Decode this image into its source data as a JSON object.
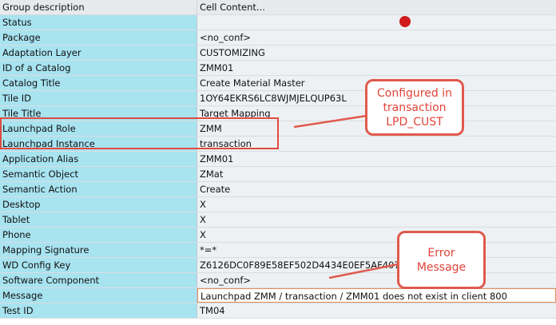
{
  "table": {
    "header": {
      "group": "Group description",
      "cell": "Cell Content..."
    },
    "rows": [
      {
        "label": "Status",
        "value": ""
      },
      {
        "label": "Package",
        "value": "<no_conf>"
      },
      {
        "label": "Adaptation Layer",
        "value": "CUSTOMIZING"
      },
      {
        "label": "ID of a Catalog",
        "value": "ZMM01"
      },
      {
        "label": "Catalog Title",
        "value": "Create Material Master"
      },
      {
        "label": "Tile ID",
        "value": "1OY64EKRS6LC8WJMJELQUP63L"
      },
      {
        "label": "Tile Title",
        "value": "Target Mapping"
      },
      {
        "label": "Launchpad Role",
        "value": "ZMM"
      },
      {
        "label": "Launchpad Instance",
        "value": "transaction"
      },
      {
        "label": "Application Alias",
        "value": "ZMM01"
      },
      {
        "label": "Semantic Object",
        "value": "ZMat"
      },
      {
        "label": "Semantic Action",
        "value": "Create"
      },
      {
        "label": "Desktop",
        "value": "X"
      },
      {
        "label": "Tablet",
        "value": "X"
      },
      {
        "label": "Phone",
        "value": "X"
      },
      {
        "label": "Mapping Signature",
        "value": "*=*"
      },
      {
        "label": "WD Config Key",
        "value": "Z6126DC0F89E58EF502D4434E0EF5AF407"
      },
      {
        "label": "Software Component",
        "value": "<no_conf>"
      },
      {
        "label": "Message",
        "value": "Launchpad ZMM / transaction / ZMM01 does not exist in client 800"
      },
      {
        "label": "Test ID",
        "value": "TM04"
      }
    ]
  },
  "status_color": "#d11a1a",
  "annotations": {
    "configured": [
      "Configured in",
      "transaction",
      "LPD_CUST"
    ],
    "error": [
      "Error",
      "Message"
    ]
  },
  "colors": {
    "label_bg": "#a8e3f0",
    "value_bg": "#eef1f3",
    "accent": "#e05a4e"
  }
}
